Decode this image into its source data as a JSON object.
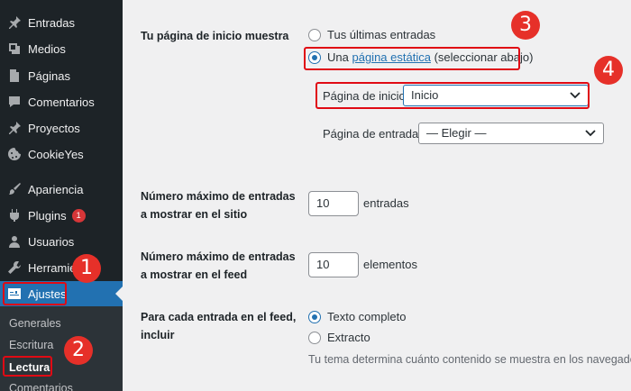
{
  "sidebar": {
    "items": [
      {
        "label": "Entradas",
        "icon": "pin-icon"
      },
      {
        "label": "Medios",
        "icon": "media-icon"
      },
      {
        "label": "Páginas",
        "icon": "pages-icon"
      },
      {
        "label": "Comentarios",
        "icon": "comments-icon"
      },
      {
        "label": "Proyectos",
        "icon": "pin-icon"
      },
      {
        "label": "CookieYes",
        "icon": "cookie-icon"
      },
      {
        "label": "Apariencia",
        "icon": "brush-icon"
      },
      {
        "label": "Plugins",
        "icon": "plugin-icon",
        "badge": "1"
      },
      {
        "label": "Usuarios",
        "icon": "users-icon"
      },
      {
        "label": "Herramientas",
        "icon": "wrench-icon"
      },
      {
        "label": "Ajustes",
        "icon": "settings-icon",
        "active": true
      }
    ],
    "submenu": [
      "Generales",
      "Escritura",
      "Lectura",
      "Comentarios"
    ],
    "submenu_current": "Lectura",
    "colors": {
      "bg": "#1d2327",
      "active": "#2271b1",
      "badge": "#d63638"
    }
  },
  "settings": {
    "front_page": {
      "label": "Tu página de inicio muestra",
      "option_latest": "Tus últimas entradas",
      "option_static_prefix": "Una",
      "option_static_link": "página estática",
      "option_static_suffix": "(seleccionar abajo)",
      "selected": "static"
    },
    "homepage": {
      "label": "Página de inicio:",
      "value": "Inicio"
    },
    "posts_page": {
      "label": "Página de entradas:",
      "value": "— Elegir —"
    },
    "posts_per_page": {
      "label": "Número máximo de entradas a mostrar en el sitio",
      "value": "10",
      "unit": "entradas"
    },
    "posts_per_rss": {
      "label": "Número máximo de entradas a mostrar en el feed",
      "value": "10",
      "unit": "elementos"
    },
    "rss_use_excerpt": {
      "label": "Para cada entrada en el feed, incluir",
      "option_full": "Texto completo",
      "option_excerpt": "Extracto",
      "selected": "full",
      "description": "Tu tema determina cuánto contenido se muestra en los navegadores"
    }
  },
  "annotations": {
    "markers": [
      "1",
      "2",
      "3",
      "4"
    ],
    "color": "#e63029"
  }
}
